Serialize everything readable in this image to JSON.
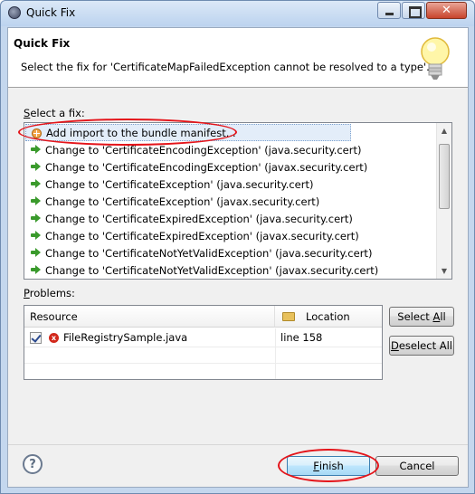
{
  "window": {
    "title": "Quick Fix"
  },
  "header": {
    "title": "Quick Fix",
    "description": "Select the fix for 'CertificateMapFailedException cannot be resolved to a type'."
  },
  "fixes": {
    "label_prefix": "S",
    "label_rest": "elect a fix:",
    "items": [
      {
        "label": "Add import to the bundle manifest...",
        "icon": "plus-icon",
        "selected": true
      },
      {
        "label": "Change to 'CertificateEncodingException' (java.security.cert)",
        "icon": "arrow-icon"
      },
      {
        "label": "Change to 'CertificateEncodingException' (javax.security.cert)",
        "icon": "arrow-icon"
      },
      {
        "label": "Change to 'CertificateException' (java.security.cert)",
        "icon": "arrow-icon"
      },
      {
        "label": "Change to 'CertificateException' (javax.security.cert)",
        "icon": "arrow-icon"
      },
      {
        "label": "Change to 'CertificateExpiredException' (java.security.cert)",
        "icon": "arrow-icon"
      },
      {
        "label": "Change to 'CertificateExpiredException' (javax.security.cert)",
        "icon": "arrow-icon"
      },
      {
        "label": "Change to 'CertificateNotYetValidException' (java.security.cert)",
        "icon": "arrow-icon"
      },
      {
        "label": "Change to 'CertificateNotYetValidException' (javax.security.cert)",
        "icon": "arrow-icon"
      }
    ]
  },
  "problems": {
    "label_prefix": "P",
    "label_rest": "roblems:",
    "columns": {
      "resource": "Resource",
      "location": "Location"
    },
    "rows": [
      {
        "resource": "FileRegistrySample.java",
        "location": "line 158",
        "checked": true
      }
    ]
  },
  "buttons": {
    "select_all_prefix": "Select ",
    "select_all_mnemonic": "A",
    "select_all_rest": "ll",
    "deselect_all_prefix": "",
    "deselect_all_mnemonic": "D",
    "deselect_all_rest": "eselect All",
    "finish_mnemonic": "F",
    "finish_rest": "inish",
    "cancel": "Cancel",
    "help": "?"
  },
  "colors": {
    "annotation": "#e4141a",
    "selection": "#e3edf9",
    "error": "#d2281b"
  }
}
